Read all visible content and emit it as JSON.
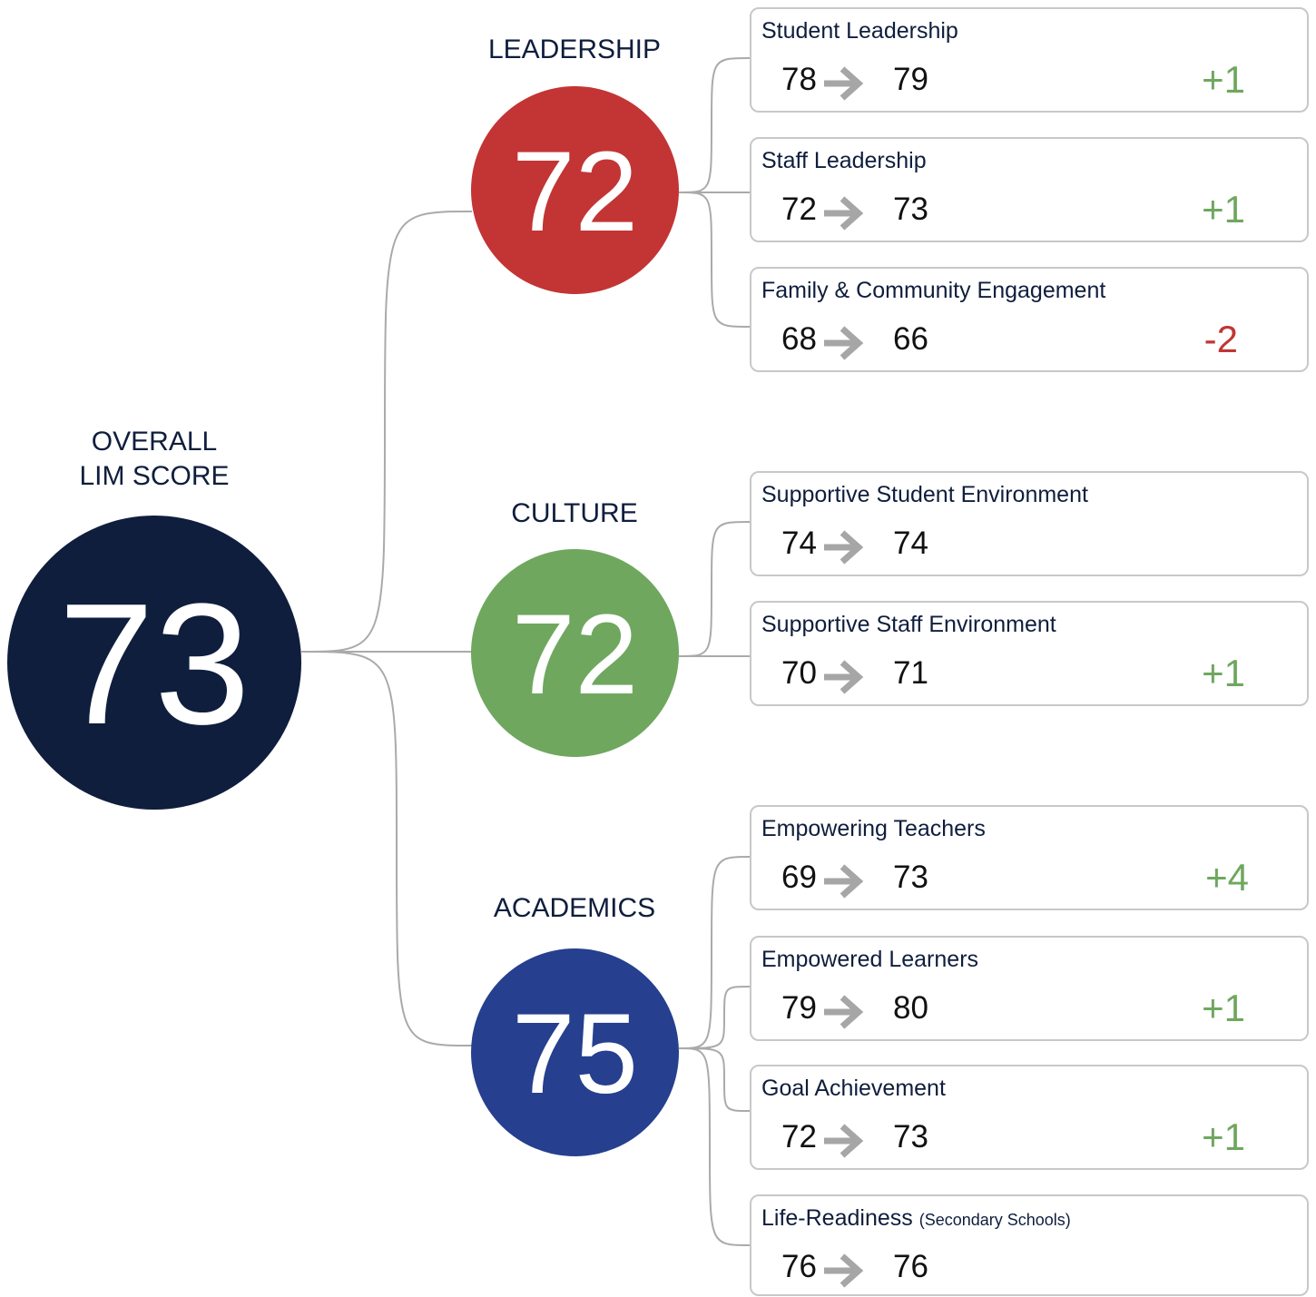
{
  "colors": {
    "overall": "#0f1e3d",
    "leadership": "#c23534",
    "culture": "#6fa75f",
    "academics": "#263f8e",
    "positive": "#6fa75f",
    "negative": "#c23534",
    "connector": "#aaaaaa",
    "arrow": "#a6a6a6"
  },
  "overall": {
    "label_line1": "OVERALL",
    "label_line2": "LIM SCORE",
    "score": "73"
  },
  "categories": [
    {
      "name": "LEADERSHIP",
      "score": "72",
      "color": "#c23534",
      "metrics": [
        {
          "title": "Student Leadership",
          "note": "",
          "from": "78",
          "to": "79",
          "change": "+1",
          "direction": "positive",
          "arrow_icon": "arrow-right-icon"
        },
        {
          "title": "Staff Leadership",
          "note": "",
          "from": "72",
          "to": "73",
          "change": "+1",
          "direction": "positive",
          "arrow_icon": "arrow-right-icon"
        },
        {
          "title": "Family & Community Engagement",
          "note": "",
          "from": "68",
          "to": "66",
          "change": "-2",
          "direction": "negative",
          "arrow_icon": "arrow-right-icon"
        }
      ]
    },
    {
      "name": "CULTURE",
      "score": "72",
      "color": "#6fa75f",
      "metrics": [
        {
          "title": "Supportive Student Environment",
          "note": "",
          "from": "74",
          "to": "74",
          "change": "",
          "direction": "none",
          "arrow_icon": "arrow-right-icon"
        },
        {
          "title": "Supportive Staff Environment",
          "note": "",
          "from": "70",
          "to": "71",
          "change": "+1",
          "direction": "positive",
          "arrow_icon": "arrow-right-icon"
        }
      ]
    },
    {
      "name": "ACADEMICS",
      "score": "75",
      "color": "#263f8e",
      "metrics": [
        {
          "title": "Empowering Teachers",
          "note": "",
          "from": "69",
          "to": "73",
          "change": "+4",
          "direction": "positive",
          "arrow_icon": "arrow-right-icon"
        },
        {
          "title": "Empowered Learners",
          "note": "",
          "from": "79",
          "to": "80",
          "change": "+1",
          "direction": "positive",
          "arrow_icon": "arrow-right-icon"
        },
        {
          "title": "Goal Achievement",
          "note": "",
          "from": "72",
          "to": "73",
          "change": "+1",
          "direction": "positive",
          "arrow_icon": "arrow-right-icon"
        },
        {
          "title": "Life-Readiness",
          "note": "(Secondary Schools)",
          "from": "76",
          "to": "76",
          "change": "",
          "direction": "none",
          "arrow_icon": "arrow-right-icon"
        }
      ]
    }
  ]
}
